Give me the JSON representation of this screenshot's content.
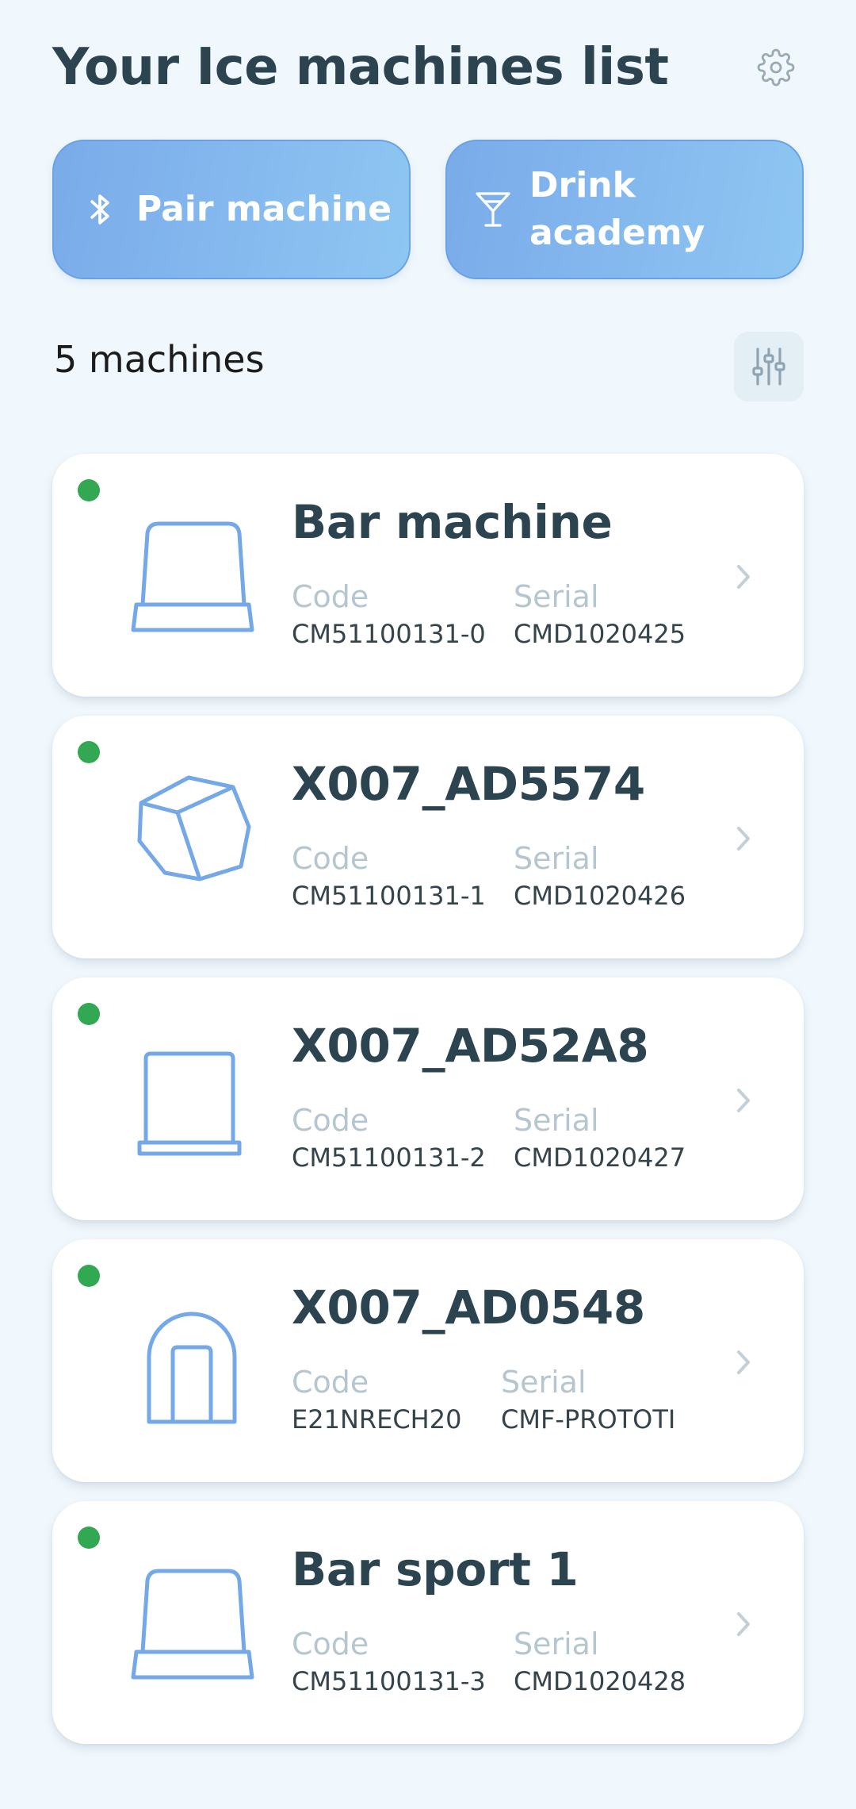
{
  "header": {
    "title": "Your Ice machines list"
  },
  "actions": {
    "pair_label": "Pair machine",
    "academy_label": "Drink academy"
  },
  "summary": {
    "count_text": "5 machines"
  },
  "labels": {
    "code": "Code",
    "serial": "Serial"
  },
  "machines": [
    {
      "name": "Bar machine",
      "code": "CM51100131-0",
      "serial": "CMD1020425",
      "icon": "bucket-ice-icon",
      "status": "online"
    },
    {
      "name": "X007_AD5574",
      "code": "CM51100131-1",
      "serial": "CMD1020426",
      "icon": "cube-ice-icon",
      "status": "online"
    },
    {
      "name": "X007_AD52A8",
      "code": "CM51100131-2",
      "serial": "CMD1020427",
      "icon": "square-ice-icon",
      "status": "online"
    },
    {
      "name": "X007_AD0548",
      "code": "E21NRECH20",
      "serial": "CMF-PROTOTI",
      "icon": "arch-ice-icon",
      "status": "online"
    },
    {
      "name": "Bar sport 1",
      "code": "CM51100131-3",
      "serial": "CMD1020428",
      "icon": "bucket-ice-icon",
      "status": "online"
    }
  ],
  "colors": {
    "background": "#f1f8fd",
    "accent": "#7aabea",
    "title": "#2b4450",
    "status_online": "#32a852",
    "icon_stroke": "#74a8e6"
  }
}
